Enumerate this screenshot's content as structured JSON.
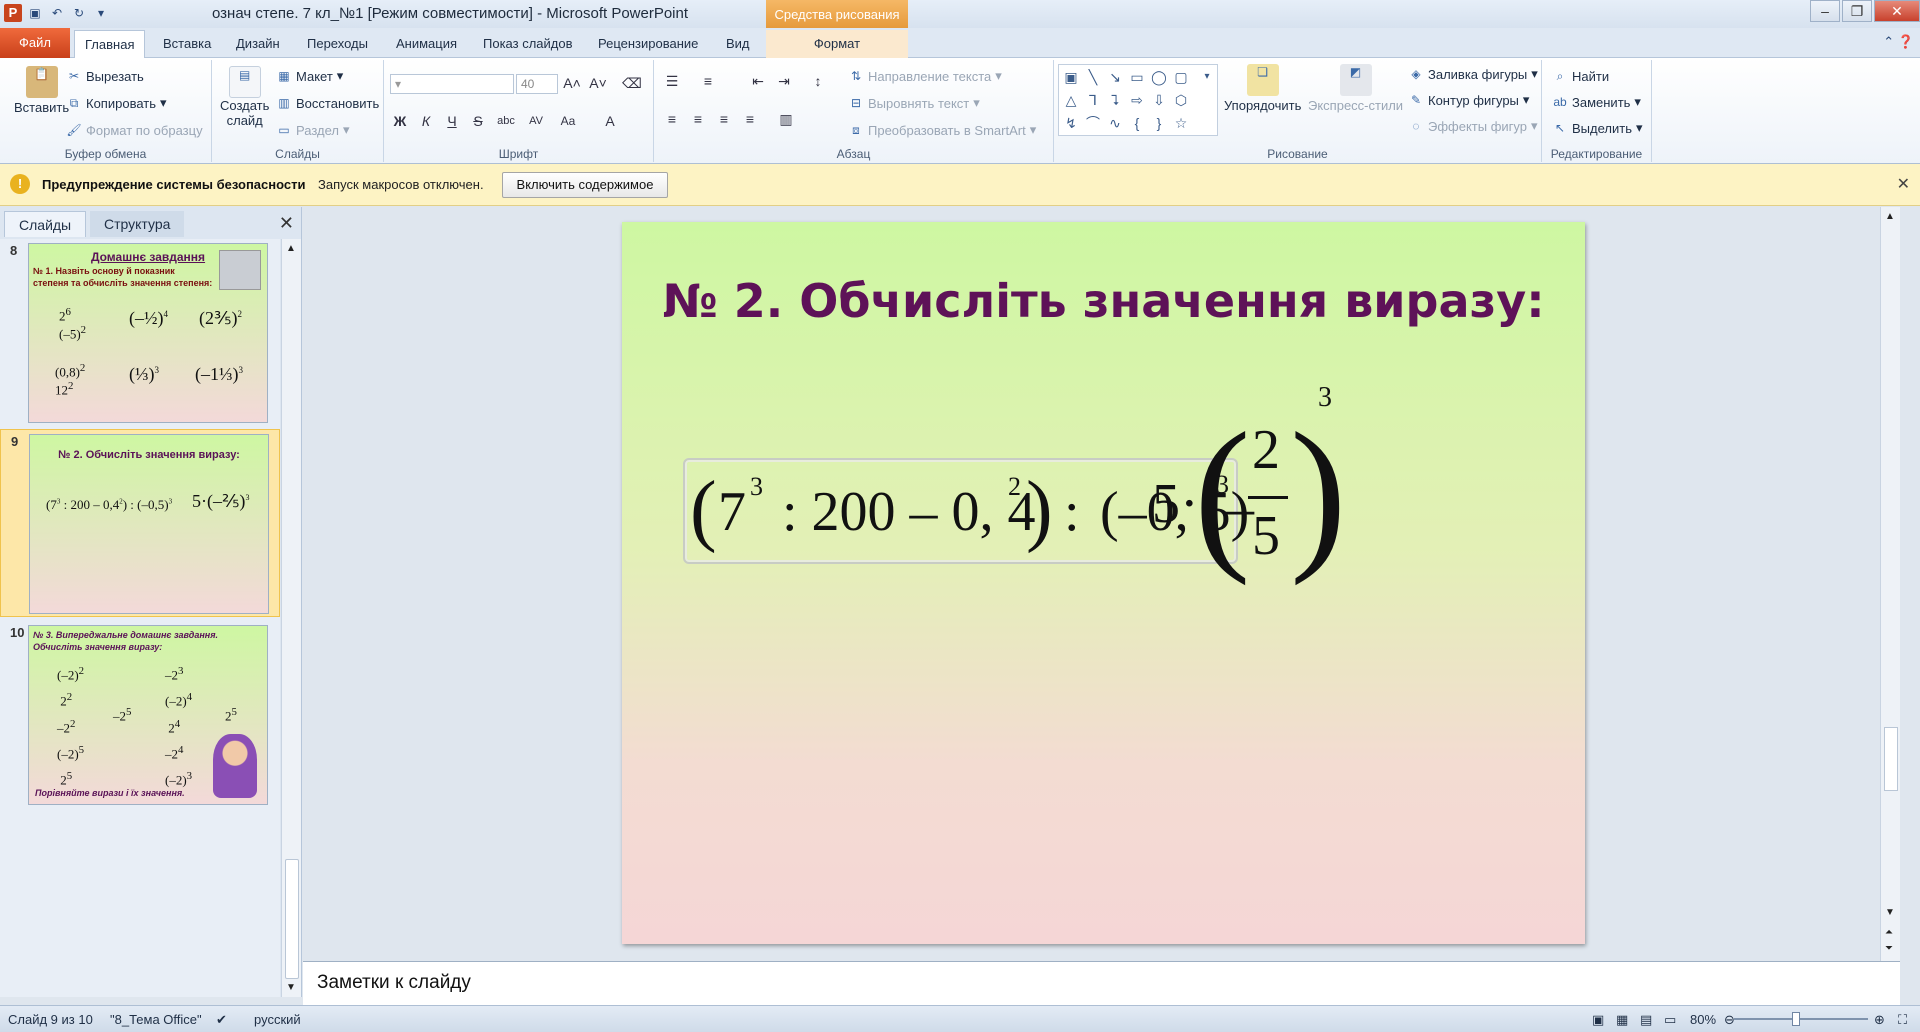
{
  "window": {
    "title": "означ степе. 7 кл_№1 [Режим совместимости]  -  Microsoft PowerPoint",
    "context_tab_head": "Средства рисования",
    "app_icon": "P"
  },
  "tabs": [
    "Файл",
    "Главная",
    "Вставка",
    "Дизайн",
    "Переходы",
    "Анимация",
    "Показ слайдов",
    "Рецензирование",
    "Вид",
    "Формат"
  ],
  "ribbon": {
    "clipboard": {
      "label": "Буфер обмена",
      "paste": "Вставить",
      "cut": "Вырезать",
      "copy": "Копировать",
      "format_painter": "Формат по образцу"
    },
    "slides": {
      "label": "Слайды",
      "new_slide_1": "Создать",
      "new_slide_2": "слайд",
      "layout": "Макет",
      "reset": "Восстановить",
      "section": "Раздел"
    },
    "font": {
      "label": "Шрифт",
      "size": "40",
      "bold": "Ж",
      "italic": "К",
      "underline": "Ч",
      "strike": "S",
      "shadow": "abc",
      "spacing": "AV",
      "case": "Aa",
      "color": "A"
    },
    "paragraph": {
      "label": "Абзац",
      "text_direction": "Направление текста",
      "align_text": "Выровнять текст",
      "smartart": "Преобразовать в SmartArt"
    },
    "drawing": {
      "label": "Рисование",
      "arrange": "Упорядочить",
      "quick_styles": "Экспресс-стили",
      "fill": "Заливка фигуры",
      "outline": "Контур фигуры",
      "effects": "Эффекты фигур"
    },
    "editing": {
      "label": "Редактирование",
      "find": "Найти",
      "replace": "Заменить",
      "select": "Выделить"
    }
  },
  "security": {
    "title": "Предупреждение системы безопасности",
    "message": "Запуск макросов отключен.",
    "button": "Включить содержимое"
  },
  "left_panel": {
    "tab_slides": "Слайды",
    "tab_outline": "Структура",
    "thumbs": [
      {
        "num": "8",
        "title": "Домашнє завдання",
        "line1": "№ 1. Назвіть основу й показник",
        "line2": "степеня та обчисліть значення степеня:"
      },
      {
        "num": "9",
        "title": "№ 2. Обчисліть  значення  виразу:"
      },
      {
        "num": "10",
        "line1": "№ 3. Випереджальне домашнє завдання.",
        "line2": "Обчисліть значення виразу:",
        "footer": "Порівняйте вирази і їх значення."
      }
    ]
  },
  "slide": {
    "title": "№ 2. Обчисліть значення виразу:",
    "expr1": {
      "open": "(",
      "base": "7",
      "exp": "3",
      "mid": " : 200 – 0, 4",
      "exp2": "2",
      "close": ")",
      "div": " : ",
      "neg": "(–0, 5)",
      "exp3": "3"
    },
    "expr2": {
      "coef": "5·",
      "minus": "–",
      "num": "2",
      "den": "5",
      "exp": "3"
    }
  },
  "notes": {
    "placeholder": "Заметки к слайду"
  },
  "status": {
    "slide_info": "Слайд 9 из 10",
    "theme": "\"8_Тема Office\"",
    "language": "русский",
    "zoom": "80%"
  }
}
